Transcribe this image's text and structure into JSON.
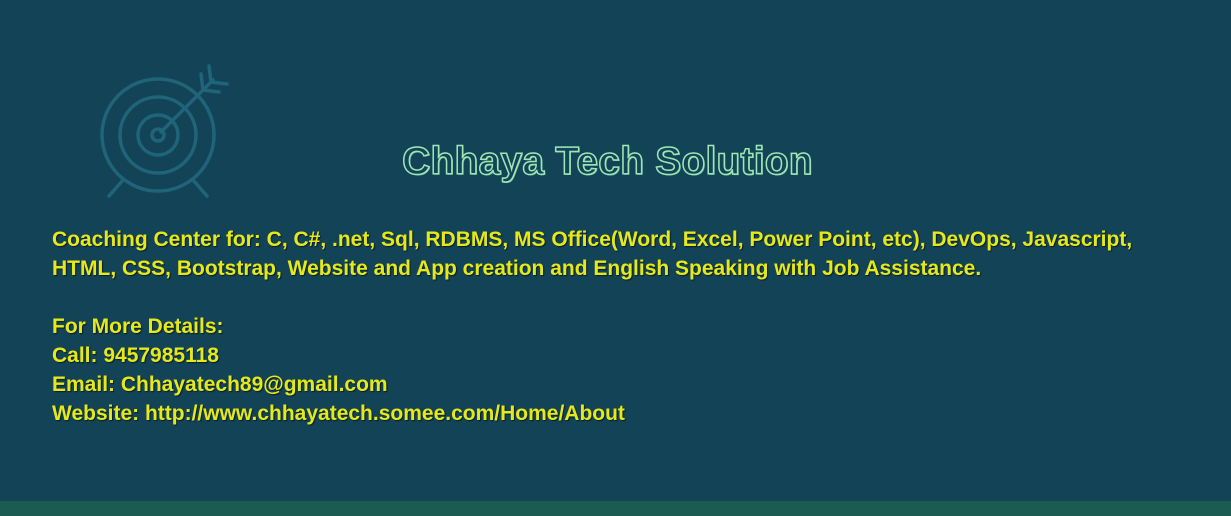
{
  "title": "Chhaya Tech Solution",
  "description": "Coaching Center for: C, C#, .net, Sql, RDBMS, MS Office(Word, Excel, Power Point, etc), DevOps, Javascript, HTML, CSS, Bootstrap, Website and App creation and English Speaking with Job Assistance.",
  "contact": {
    "heading": "For More Details:",
    "call": "Call: 9457985118",
    "email": "Email: Chhayatech89@gmail.com",
    "website": "Website: http://www.chhayatech.somee.com/Home/About"
  },
  "colors": {
    "background": "#124356",
    "body_text": "#e6e81a",
    "title_outline": "#9ee6b6",
    "icon_stroke": "#1f6479",
    "bottom_bar": "#1c5b51"
  },
  "icons": [
    "target-icon"
  ]
}
